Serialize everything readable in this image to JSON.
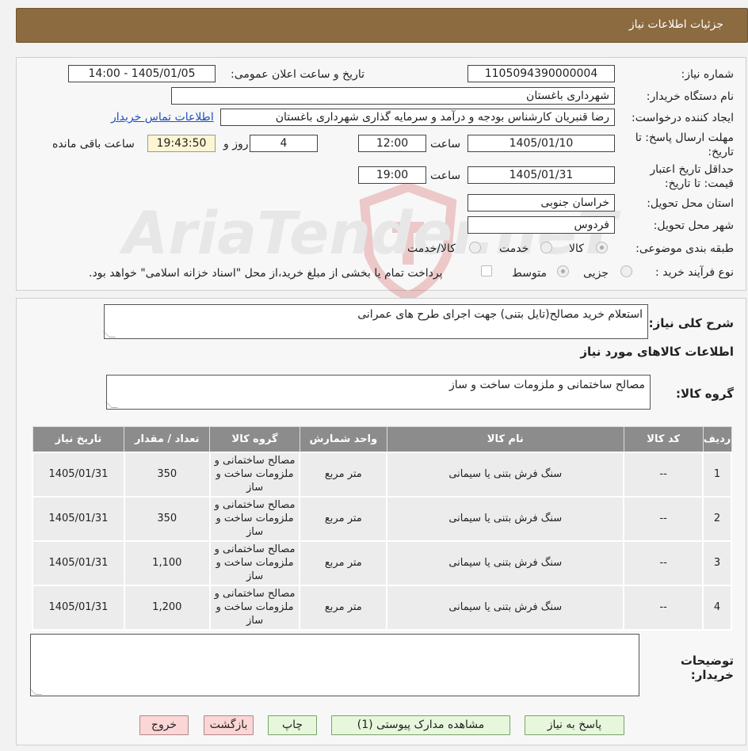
{
  "header": {
    "title": "جزئیات اطلاعات نیاز"
  },
  "form": {
    "need_number_label": "شماره نیاز:",
    "need_number": "1105094390000004",
    "announce_label": "تاریخ و ساعت اعلان عمومی:",
    "announce_value": "1405/01/05 - 14:00",
    "buyer_org_label": "نام دستگاه خریدار:",
    "buyer_org": "شهرداری باغستان",
    "requester_label": "ایجاد کننده درخواست:",
    "requester": "رضا قنبریان کارشناس بودجه و درآمد و سرمایه گذاری شهرداری باغستان",
    "buyer_contact_link": "اطلاعات تماس خریدار",
    "deadline_label_1": "مهلت ارسال پاسخ: تا",
    "deadline_label_2": "تاریخ:",
    "deadline_date": "1405/01/10",
    "time_label": "ساعت",
    "deadline_time": "12:00",
    "days_value": "4",
    "days_label": "روز و",
    "remaining_time": "19:43:50",
    "remaining_label": "ساعت باقی مانده",
    "validity_label_1": "حداقل تاریخ اعتبار",
    "validity_label_2": "قیمت: تا تاریخ:",
    "validity_date": "1405/01/31",
    "validity_time": "19:00",
    "province_label": "استان محل تحویل:",
    "province": "خراسان جنوبی",
    "city_label": "شهر محل تحویل:",
    "city": "فردوس",
    "category_label": "طبقه بندی موضوعی:",
    "category_options": [
      "کالا",
      "خدمت",
      "کالا/خدمت"
    ],
    "category_selected": "کالا",
    "process_label": "نوع فرآیند خرید :",
    "process_options": [
      "جزیی",
      "متوسط"
    ],
    "process_selected": "متوسط",
    "payment_note": "پرداخت تمام یا بخشی از مبلغ خرید،از محل \"اسناد خزانه اسلامی\" خواهد بود."
  },
  "watermark": {
    "text": "AriaTender.neT"
  },
  "summary": {
    "label": "شرح کلی نیاز:",
    "text": "استعلام خرید مصالح(تایل بتنی) جهت اجرای طرح های عمرانی"
  },
  "goods": {
    "section_title": "اطلاعات کالاهای مورد نیاز",
    "group_label": "گروه کالا:",
    "group_value": "مصالح ساختمانی و ملزومات ساخت و ساز"
  },
  "table": {
    "headers": [
      "ردیف",
      "کد کالا",
      "نام کالا",
      "واحد شمارش",
      "گروه کالا",
      "تعداد / مقدار",
      "تاریخ نیاز"
    ],
    "rows": [
      [
        "1",
        "--",
        "سنگ فرش بتنی یا سیمانی",
        "متر مربع",
        "مصالح ساختمانی و ملزومات ساخت و ساز",
        "350",
        "1405/01/31"
      ],
      [
        "2",
        "--",
        "سنگ فرش بتنی یا سیمانی",
        "متر مربع",
        "مصالح ساختمانی و ملزومات ساخت و ساز",
        "350",
        "1405/01/31"
      ],
      [
        "3",
        "--",
        "سنگ فرش بتنی یا سیمانی",
        "متر مربع",
        "مصالح ساختمانی و ملزومات ساخت و ساز",
        "1,100",
        "1405/01/31"
      ],
      [
        "4",
        "--",
        "سنگ فرش بتنی یا سیمانی",
        "متر مربع",
        "مصالح ساختمانی و ملزومات ساخت و ساز",
        "1,200",
        "1405/01/31"
      ]
    ]
  },
  "notes": {
    "label_1": "توضیحات",
    "label_2": "خریدار:",
    "value": ""
  },
  "buttons": {
    "reply": "پاسخ به نیاز",
    "attachments": "مشاهده مدارک پیوستی (1)",
    "print": "چاپ",
    "back": "بازگشت",
    "exit": "خروج"
  }
}
